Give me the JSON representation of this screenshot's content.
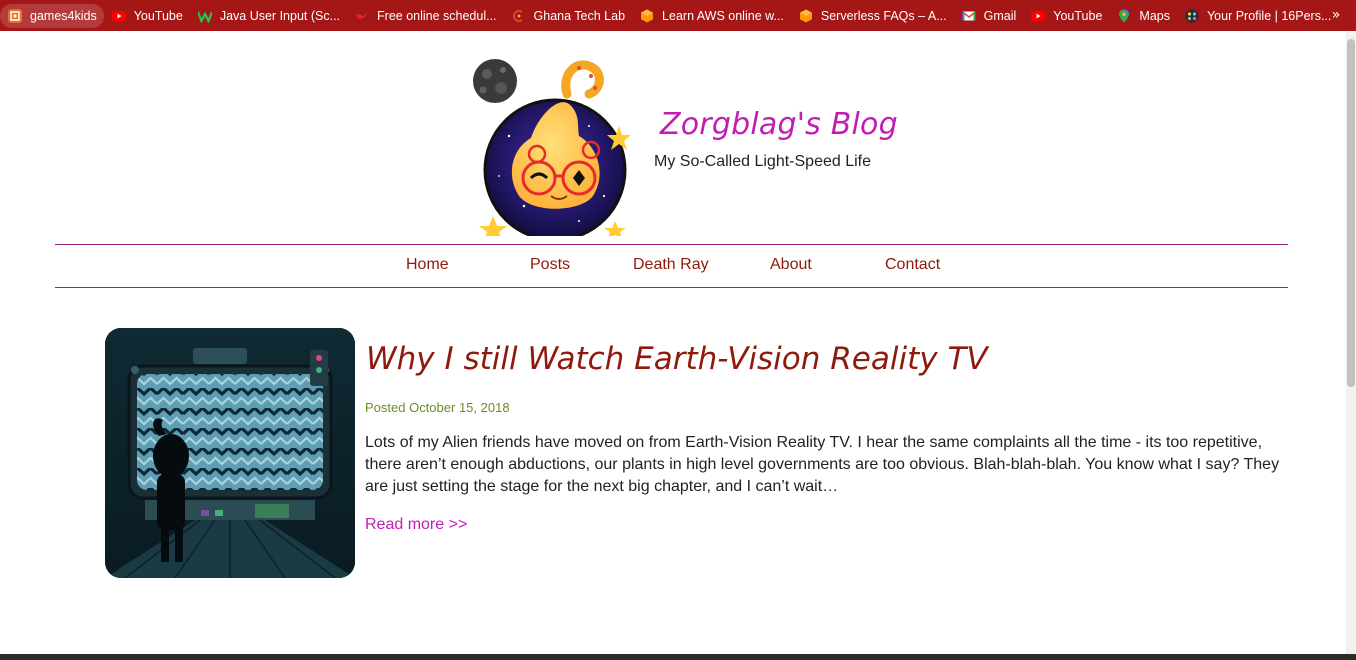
{
  "bookmarks": {
    "items": [
      {
        "label": "games4kids",
        "icon": "games4kids-icon"
      },
      {
        "label": "YouTube",
        "icon": "youtube-icon"
      },
      {
        "label": "Java User Input (Sc...",
        "icon": "w-logo-icon"
      },
      {
        "label": "Free online schedul...",
        "icon": "bird-icon"
      },
      {
        "label": "Ghana Tech Lab",
        "icon": "ghana-tech-lab-icon"
      },
      {
        "label": "Learn AWS online w...",
        "icon": "aws-icon"
      },
      {
        "label": "Serverless FAQs – A...",
        "icon": "aws-icon"
      },
      {
        "label": "Gmail",
        "icon": "gmail-icon"
      },
      {
        "label": "YouTube",
        "icon": "youtube-icon"
      },
      {
        "label": "Maps",
        "icon": "maps-pin-icon"
      },
      {
        "label": "Your Profile | 16Pers...",
        "icon": "16personalities-icon"
      }
    ],
    "overflow_icon": "chevron-double-right-icon",
    "overflow_glyph": "»"
  },
  "site": {
    "title": "Zorgblag's Blog",
    "tagline": "My So-Called Light-Speed Life",
    "logo_icon": "alien-avatar-logo"
  },
  "nav": {
    "items": [
      "Home",
      "Posts",
      "Death Ray",
      "About",
      "Contact"
    ]
  },
  "post": {
    "title": "Why I still Watch Earth-Vision Reality TV",
    "date": "Posted October 15, 2018",
    "excerpt": "Lots of my Alien friends have moved on from Earth-Vision Reality TV. I hear the same complaints all the time - its too repetitive, there aren’t enough abductions, our plants in high level governments are too obvious. Blah-blah-blah. You know what I say? They are just setting the stage for the next big chapter, and I can’t wait…",
    "read_more": "Read more >>",
    "thumbnail_icon": "alien-watching-tv-thumbnail"
  },
  "colors": {
    "bookmark_bar": "#a51616",
    "title_magenta": "#c21cb4",
    "nav_text": "#8e1a0c",
    "date_green": "#6b8e23"
  }
}
